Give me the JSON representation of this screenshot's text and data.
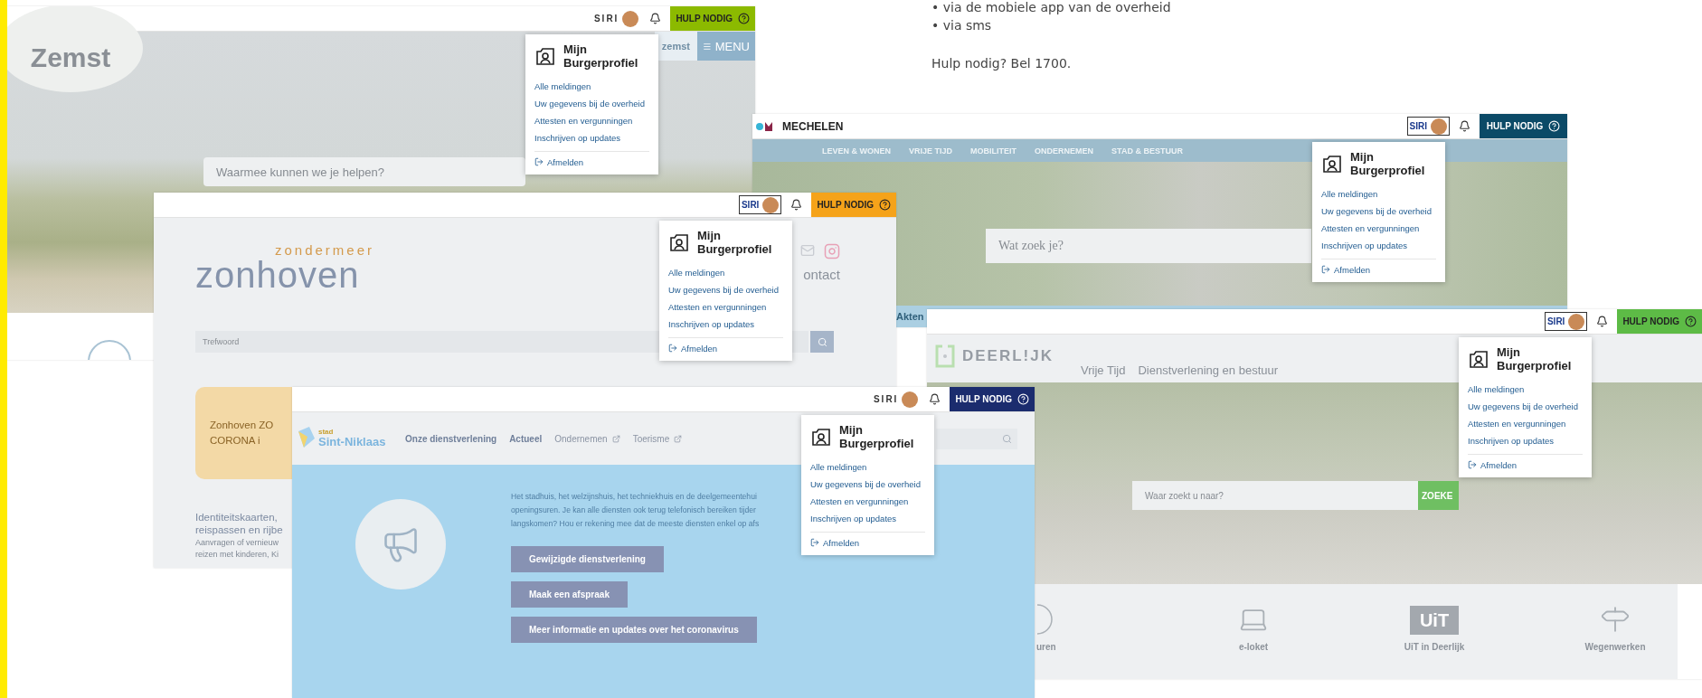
{
  "side_text": {
    "lines": [
      "• via de mobiele app van de overheid",
      "• via sms"
    ],
    "note": "Hulp nodig? Bel 1700."
  },
  "windows": [
    {
      "kind": "landscape",
      "header": {
        "user": "SIRI",
        "user_boxed": false,
        "help": {
          "label": "HULP NODIG",
          "color": "#8cba00"
        }
      },
      "profile_menu": {
        "title": "Mijn Burgerprofiel",
        "links": [
          "Alle meldingen",
          "Uw gegevens bij de overheid",
          "Attesten en vergunningen",
          "Inschrijven op updates"
        ],
        "logout": "Afmelden"
      },
      "logo": "Zemst",
      "site_link": "zemst",
      "menu_button": "MENU",
      "search": {
        "placeholder": "Waarmee kunnen we je helpen?"
      }
    },
    {
      "kind": "city-nav",
      "header": {
        "user": "SIRI",
        "user_boxed": true,
        "help": {
          "label": "HULP NODIG",
          "color": "#0b4a67"
        }
      },
      "profile_menu": {
        "title": "Mijn Burgerprofiel",
        "links": [
          "Alle meldingen",
          "Uw gegevens bij de overheid",
          "Attesten en vergunningen",
          "Inschrijven op updates"
        ],
        "logout": "Afmelden"
      },
      "logo": "MECHELEN",
      "nav": [
        "LEVEN & WONEN",
        "VRIJE TIJD",
        "MOBILITEIT",
        "ONDERNEMEN",
        "STAD & BESTUUR"
      ],
      "search": {
        "placeholder": "Wat zoek je?"
      },
      "tiles": [
        "Akten"
      ]
    },
    {
      "kind": "logo-search",
      "header": {
        "user": "SIRI",
        "user_boxed": true,
        "help": {
          "label": "HULP NODIG",
          "color": "#f5a31a"
        }
      },
      "profile_menu": {
        "title": "Mijn Burgerprofiel",
        "links": [
          "Alle meldingen",
          "Uw gegevens bij de overheid",
          "Attesten en vergunningen",
          "Inschrijven op updates"
        ],
        "logout": "Afmelden"
      },
      "logo": {
        "tagline": "zondermeer",
        "name": "zonhoven"
      },
      "contact": "ontact",
      "search": {
        "placeholder": "Trefwoord"
      },
      "card": {
        "lines": [
          "Zonhoven ZO",
          "CORONA i"
        ]
      },
      "article": {
        "title_lines": [
          "Identiteitskaarten,",
          "reispassen en rijbe"
        ],
        "text_lines": [
          "Aanvragen of vernieuw",
          "reizen met kinderen, Ki"
        ]
      }
    },
    {
      "kind": "photo-tiles",
      "header": {
        "user": "SIRI",
        "user_boxed": true,
        "help": {
          "label": "HULP NODIG",
          "color": "#5dbb46"
        }
      },
      "profile_menu": {
        "title": "Mijn Burgerprofiel",
        "links": [
          "Alle meldingen",
          "Uw gegevens bij de overheid",
          "Attesten en vergunningen",
          "Inschrijven op updates"
        ],
        "logout": "Afmelden"
      },
      "logo": "DEERL!JK",
      "nav": [
        "Vrije Tijd",
        "Dienstverlening en bestuur"
      ],
      "search": {
        "placeholder": "Waar zoekt u naar?",
        "button": "ZOEKE"
      },
      "tiles": [
        {
          "kind": "clock",
          "label": "uren"
        },
        {
          "kind": "laptop",
          "label": "e-loket"
        },
        {
          "kind": "badge",
          "badge": "UiT",
          "label": "UiT in Deerlijk"
        },
        {
          "kind": "signpost",
          "label": "Wegenwerken"
        }
      ]
    },
    {
      "kind": "campaign",
      "header": {
        "user": "SIRI",
        "user_boxed": false,
        "help": {
          "label": "HULP NODIG",
          "color": "#1b2c6e"
        }
      },
      "profile_menu": {
        "title": "Mijn Burgerprofiel",
        "links": [
          "Alle meldingen",
          "Uw gegevens bij de overheid",
          "Attesten en vergunningen",
          "Inschrijven op updates"
        ],
        "logout": "Afmelden"
      },
      "logo": {
        "tagline": "stad",
        "name": "Sint-Niklaas"
      },
      "nav": [
        {
          "label": "Onze dienstverlening",
          "external": false
        },
        {
          "label": "Actueel",
          "external": false
        },
        {
          "label": "Ondernemen",
          "external": true
        },
        {
          "label": "Toerisme",
          "external": true
        }
      ],
      "intro_lines": [
        "Het stadhuis, het welzijnshuis, het techniekhuis en de deelgemeentehui",
        "openingsuren. Je kan alle diensten ook terug telefonisch bereiken tijder",
        "langskomen? Hou er rekening mee dat de meeste diensten enkel op afs"
      ],
      "buttons": [
        "Gewijzigde dienstverlening",
        "Maak een afspraak",
        "Meer informatie en updates over het coronavirus"
      ]
    }
  ]
}
